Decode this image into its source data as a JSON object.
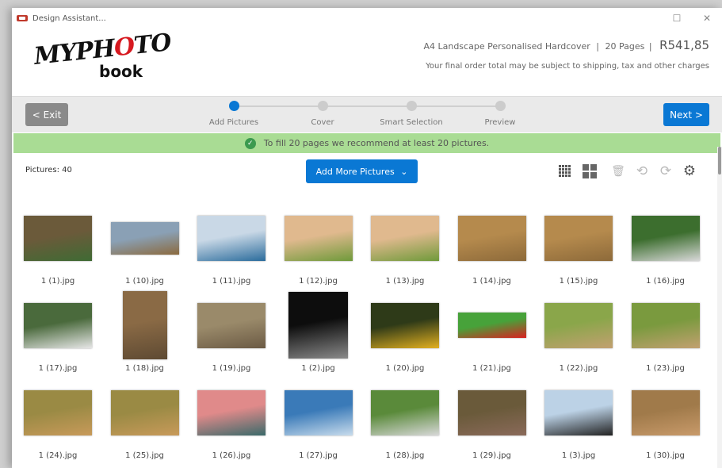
{
  "window": {
    "title": "Design Assistant...",
    "minimize": "☐",
    "close": "✕"
  },
  "logo": {
    "my": "MY",
    "pho": "PH",
    "o": "O",
    "to": "TO",
    "book": "book"
  },
  "product": {
    "description": "A4 Landscape Personalised Hardcover",
    "sep1": "|",
    "pages": "20 Pages",
    "sep2": "|",
    "price": "R541,85",
    "note": "Your final order total may be subject to shipping, tax and other charges"
  },
  "nav": {
    "exit_label": "< Exit",
    "next_label": "Next >",
    "steps": [
      {
        "label": "Add Pictures",
        "active": true
      },
      {
        "label": "Cover",
        "active": false
      },
      {
        "label": "Smart Selection",
        "active": false
      },
      {
        "label": "Preview",
        "active": false
      }
    ]
  },
  "alert": {
    "text": "To fill 20 pages we recommend at least 20 pictures."
  },
  "toolbar": {
    "count_label": "Pictures: 40",
    "add_more_label": "Add More Pictures",
    "caret": "⌄"
  },
  "icons": {
    "trash": "🗑",
    "rotate_left": "⟲",
    "rotate_right": "⟳",
    "settings": "⚙"
  },
  "photos": [
    {
      "name": "1 (1).jpg",
      "c1": "#6b5a3a",
      "c2": "#3f6b34",
      "shape": "wide"
    },
    {
      "name": "1 (10).jpg",
      "c1": "#8aa0b5",
      "c2": "#8b6a3e",
      "shape": "flat"
    },
    {
      "name": "1 (11).jpg",
      "c1": "#c9d8e6",
      "c2": "#2b6c9c",
      "shape": "wide"
    },
    {
      "name": "1 (12).jpg",
      "c1": "#e0b98e",
      "c2": "#6f9a3a",
      "shape": "wide"
    },
    {
      "name": "1 (13).jpg",
      "c1": "#e0b98e",
      "c2": "#6f9a3a",
      "shape": "wide"
    },
    {
      "name": "1 (14).jpg",
      "c1": "#b58a4d",
      "c2": "#8d6a3a",
      "shape": "wide"
    },
    {
      "name": "1 (15).jpg",
      "c1": "#b58a4d",
      "c2": "#8d6a3a",
      "shape": "wide"
    },
    {
      "name": "1 (16).jpg",
      "c1": "#3c6e2e",
      "c2": "#d8d8d8",
      "shape": "wide"
    },
    {
      "name": "1 (17).jpg",
      "c1": "#4a6a3c",
      "c2": "#e6e6e6",
      "shape": "wide"
    },
    {
      "name": "1 (18).jpg",
      "c1": "#8a6a45",
      "c2": "#5e4a33",
      "shape": "tall"
    },
    {
      "name": "1 (19).jpg",
      "c1": "#9a8a6a",
      "c2": "#6b5a44",
      "shape": "wide"
    },
    {
      "name": "1 (2).jpg",
      "c1": "#0d0d0d",
      "c2": "#8a8a8a",
      "shape": "square"
    },
    {
      "name": "1 (20).jpg",
      "c1": "#2e3a18",
      "c2": "#e2b020",
      "shape": "wide"
    },
    {
      "name": "1 (21).jpg",
      "c1": "#47a23a",
      "c2": "#d92020",
      "shape": "flat2"
    },
    {
      "name": "1 (22).jpg",
      "c1": "#8aa64a",
      "c2": "#c2a070",
      "shape": "wide"
    },
    {
      "name": "1 (23).jpg",
      "c1": "#7a9a3e",
      "c2": "#c2a070",
      "shape": "wide"
    },
    {
      "name": "1 (24).jpg",
      "c1": "#9a8a44",
      "c2": "#c89a5a",
      "shape": "wide"
    },
    {
      "name": "1 (25).jpg",
      "c1": "#9a8a44",
      "c2": "#c89a5a",
      "shape": "wide"
    },
    {
      "name": "1 (26).jpg",
      "c1": "#e08a8a",
      "c2": "#3a6a6a",
      "shape": "wide"
    },
    {
      "name": "1 (27).jpg",
      "c1": "#3a7ab8",
      "c2": "#c8dcec",
      "shape": "wide"
    },
    {
      "name": "1 (28).jpg",
      "c1": "#5a8a3a",
      "c2": "#d8d8d8",
      "shape": "wide"
    },
    {
      "name": "1 (29).jpg",
      "c1": "#6a5a3a",
      "c2": "#8a6a5a",
      "shape": "wide"
    },
    {
      "name": "1 (3).jpg",
      "c1": "#bcd2e6",
      "c2": "#222222",
      "shape": "wide"
    },
    {
      "name": "1 (30).jpg",
      "c1": "#a07a4a",
      "c2": "#c89a6a",
      "shape": "wide"
    }
  ]
}
